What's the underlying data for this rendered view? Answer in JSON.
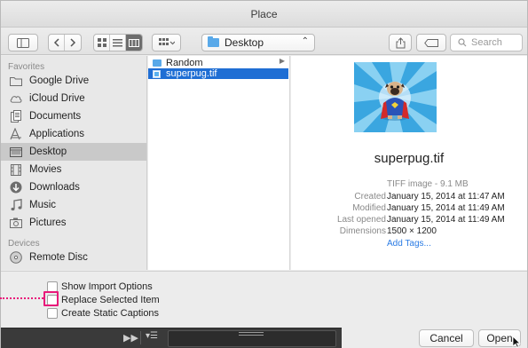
{
  "window": {
    "title": "Place"
  },
  "toolbar": {
    "location": "Desktop",
    "search_placeholder": "Search"
  },
  "sidebar": {
    "favorites_header": "Favorites",
    "devices_header": "Devices",
    "items": [
      {
        "label": "Google Drive",
        "icon": "folder-icon"
      },
      {
        "label": "iCloud Drive",
        "icon": "cloud-icon"
      },
      {
        "label": "Documents",
        "icon": "documents-icon"
      },
      {
        "label": "Applications",
        "icon": "applications-icon"
      },
      {
        "label": "Desktop",
        "icon": "desktop-icon",
        "selected": true
      },
      {
        "label": "Movies",
        "icon": "film-icon"
      },
      {
        "label": "Downloads",
        "icon": "download-icon"
      },
      {
        "label": "Music",
        "icon": "music-icon"
      },
      {
        "label": "Pictures",
        "icon": "camera-icon"
      }
    ],
    "devices": [
      {
        "label": "Remote Disc",
        "icon": "disc-icon"
      }
    ]
  },
  "files": [
    {
      "name": "Random",
      "type": "folder"
    },
    {
      "name": "superpug.tif",
      "type": "image",
      "selected": true
    }
  ],
  "preview": {
    "name": "superpug.tif",
    "kind": "TIFF image - 9.1 MB",
    "info": [
      {
        "key": "Created",
        "value": "January 15, 2014 at 11:47 AM"
      },
      {
        "key": "Modified",
        "value": "January 15, 2014 at 11:49 AM"
      },
      {
        "key": "Last opened",
        "value": "January 15, 2014 at 11:49 AM"
      },
      {
        "key": "Dimensions",
        "value": "1500 × 1200"
      }
    ],
    "add_tags": "Add Tags..."
  },
  "options": [
    {
      "label": "Show Import Options"
    },
    {
      "label": "Replace Selected Item"
    },
    {
      "label": "Create Static Captions"
    }
  ],
  "buttons": {
    "cancel": "Cancel",
    "open": "Open"
  },
  "colors": {
    "accent": "#1f6ed4",
    "highlight": "#e8197a",
    "folder": "#59a9e9"
  }
}
